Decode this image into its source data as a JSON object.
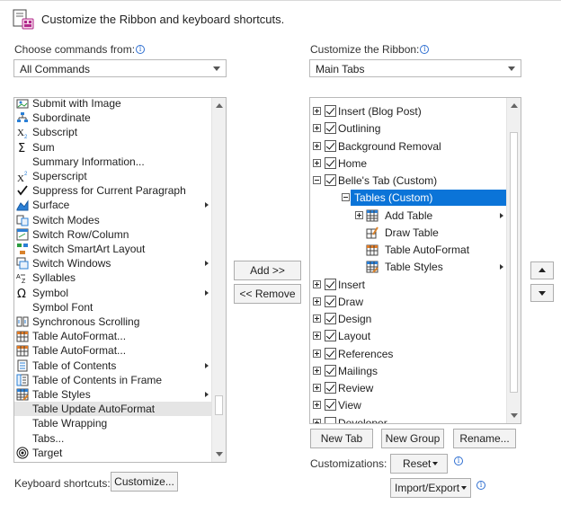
{
  "header": {
    "title": "Customize the Ribbon and keyboard shortcuts."
  },
  "left": {
    "choose_label": "Choose commands from:",
    "choose_value": "All Commands",
    "items": [
      {
        "label": "Submit with Image",
        "icon": "submit-image-icon",
        "sub": false
      },
      {
        "label": "Subordinate",
        "icon": "org-chart-icon",
        "sub": false
      },
      {
        "label": "Subscript",
        "icon": "subscript-icon",
        "sub": false
      },
      {
        "label": "Sum",
        "icon": "sigma-icon",
        "sub": false
      },
      {
        "label": "Summary Information...",
        "icon": "",
        "sub": false
      },
      {
        "label": "Superscript",
        "icon": "superscript-icon",
        "sub": false
      },
      {
        "label": "Suppress for Current Paragraph",
        "icon": "checkmark-icon",
        "sub": false
      },
      {
        "label": "Surface",
        "icon": "surface-icon",
        "sub": true
      },
      {
        "label": "Switch Modes",
        "icon": "switch-modes-icon",
        "sub": false
      },
      {
        "label": "Switch Row/Column",
        "icon": "switch-row-column-icon",
        "sub": false
      },
      {
        "label": "Switch SmartArt Layout",
        "icon": "smartart-icon",
        "sub": false
      },
      {
        "label": "Switch Windows",
        "icon": "switch-windows-icon",
        "sub": true
      },
      {
        "label": "Syllables",
        "icon": "syllables-icon",
        "sub": false
      },
      {
        "label": "Symbol",
        "icon": "omega-icon",
        "sub": true
      },
      {
        "label": "Symbol Font",
        "icon": "",
        "sub": false
      },
      {
        "label": "Synchronous Scrolling",
        "icon": "sync-scroll-icon",
        "sub": false
      },
      {
        "label": "Table AutoFormat...",
        "icon": "table-autoformat-icon",
        "sub": false
      },
      {
        "label": "Table AutoFormat...",
        "icon": "table-autoformat-icon",
        "sub": false
      },
      {
        "label": "Table of Contents",
        "icon": "toc-icon",
        "sub": true
      },
      {
        "label": "Table of Contents in Frame",
        "icon": "toc-frame-icon",
        "sub": false
      },
      {
        "label": "Table Styles",
        "icon": "table-styles-icon",
        "sub": true
      },
      {
        "label": "Table Update AutoFormat",
        "icon": "",
        "sub": false
      },
      {
        "label": "Table Wrapping",
        "icon": "",
        "sub": false
      },
      {
        "label": "Tabs...",
        "icon": "",
        "sub": false
      },
      {
        "label": "Target",
        "icon": "target-icon",
        "sub": false
      }
    ],
    "selected_index": 21
  },
  "middle": {
    "add_label": "Add >>",
    "remove_label": "<< Remove"
  },
  "right": {
    "customize_label": "Customize the Ribbon:",
    "customize_value": "Main Tabs",
    "tree": [
      {
        "label": "Insert (Blog Post)",
        "level": 0,
        "expander": "plus",
        "checked": true
      },
      {
        "label": "Outlining",
        "level": 0,
        "expander": "plus",
        "checked": true
      },
      {
        "label": "Background Removal",
        "level": 0,
        "expander": "plus",
        "checked": true
      },
      {
        "label": "Home",
        "level": 0,
        "expander": "plus",
        "checked": true
      },
      {
        "label": "Belle's Tab (Custom)",
        "level": 0,
        "expander": "minus",
        "checked": true
      },
      {
        "label": "Tables (Custom)",
        "level": 1,
        "expander": "minus",
        "highlighted": true
      },
      {
        "label": "Add Table",
        "level": 2,
        "expander": "plus",
        "icon": "add-table-icon",
        "sub": true
      },
      {
        "label": "Draw Table",
        "level": 2,
        "icon": "draw-table-icon"
      },
      {
        "label": "Table AutoFormat",
        "level": 2,
        "icon": "table-autoformat-icon"
      },
      {
        "label": "Table Styles",
        "level": 2,
        "icon": "table-styles-icon",
        "sub": true
      },
      {
        "label": "Insert",
        "level": 0,
        "expander": "plus",
        "checked": true
      },
      {
        "label": "Draw",
        "level": 0,
        "expander": "plus",
        "checked": true
      },
      {
        "label": "Design",
        "level": 0,
        "expander": "plus",
        "checked": true
      },
      {
        "label": "Layout",
        "level": 0,
        "expander": "plus",
        "checked": true
      },
      {
        "label": "References",
        "level": 0,
        "expander": "plus",
        "checked": true
      },
      {
        "label": "Mailings",
        "level": 0,
        "expander": "plus",
        "checked": true
      },
      {
        "label": "Review",
        "level": 0,
        "expander": "plus",
        "checked": true
      },
      {
        "label": "View",
        "level": 0,
        "expander": "plus",
        "checked": true
      },
      {
        "label": "Developer",
        "level": 0,
        "expander": "plus",
        "checked": false
      }
    ],
    "new_tab": "New Tab",
    "new_group": "New Group",
    "rename": "Rename...",
    "customizations_label": "Customizations:",
    "reset": "Reset",
    "import_export": "Import/Export"
  },
  "footer": {
    "keyboard_label": "Keyboard shortcuts:",
    "customize_btn": "Customize..."
  }
}
